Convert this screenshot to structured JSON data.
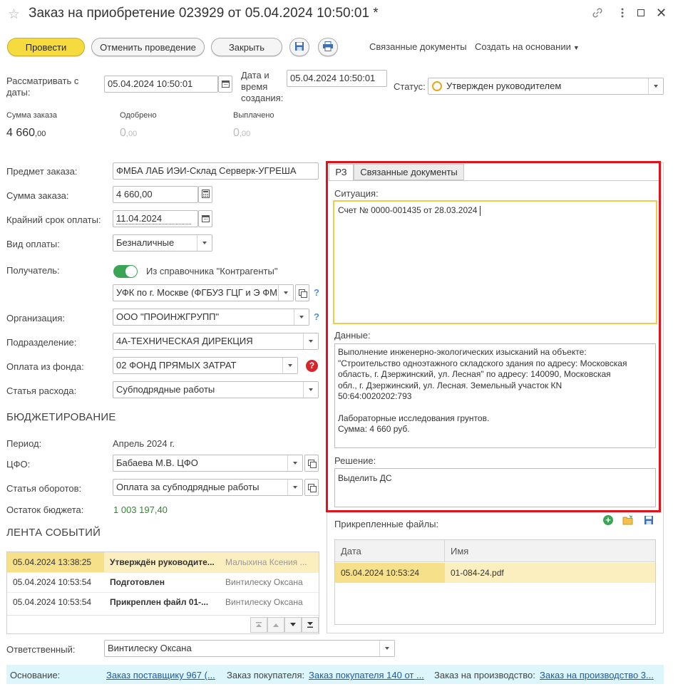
{
  "window": {
    "title": "Заказ на приобретение 023929 от 05.04.2024 10:50:01 *"
  },
  "toolbar": {
    "post_label": "Провести",
    "cancel_post_label": "Отменить проведение",
    "close_label": "Закрыть",
    "related_docs_label": "Связанные документы",
    "create_based_label": "Создать на основании"
  },
  "header": {
    "consider_from_label": "Рассматривать с даты:",
    "consider_from_value": "05.04.2024 10:50:01",
    "created_label": "Дата и время создания:",
    "created_value": "05.04.2024 10:50:01",
    "status_label": "Статус:",
    "status_value": "Утвержден руководителем"
  },
  "totals": {
    "order_sum_label": "Сумма заказа",
    "order_sum_int": "4 660",
    "order_sum_dec": ",00",
    "approved_label": "Одобрено",
    "approved_int": "0",
    "approved_dec": ",00",
    "paid_label": "Выплачено",
    "paid_int": "0",
    "paid_dec": ",00"
  },
  "form": {
    "subject_label": "Предмет заказа:",
    "subject_value": "ФМБА ЛАБ ИЭИ-Склад Серверк-УГРЕША",
    "sum_label": "Сумма заказа:",
    "sum_value": "4 660,00",
    "deadline_label": "Крайний срок оплаты:",
    "deadline_value": "11.04.2024",
    "payment_type_label": "Вид оплаты:",
    "payment_type_value": "Безналичные",
    "recipient_label": "Получатель:",
    "recipient_toggle_label": "Из справочника \"Контрагенты\"",
    "recipient_value": "УФК по г. Москве (ФГБУЗ ГЦГ и Э ФМБА",
    "org_label": "Организация:",
    "org_value": "ООО \"ПРОИНЖГРУПП\"",
    "dept_label": "Подразделение:",
    "dept_value": "4А-ТЕХНИЧЕСКАЯ ДИРЕКЦИЯ",
    "fund_label": "Оплата из фонда:",
    "fund_value": "02 ФОНД ПРЯМЫХ ЗАТРАТ",
    "expense_label": "Статья расхода:",
    "expense_value": "Субподрядные работы"
  },
  "budget": {
    "title": "БЮДЖЕТИРОВАНИЕ",
    "period_label": "Период:",
    "period_value": "Апрель 2024 г.",
    "cfo_label": "ЦФО:",
    "cfo_value": "Бабаева М.В. ЦФО",
    "turnover_label": "Статья оборотов:",
    "turnover_value": "Оплата за субподрядные работы",
    "remainder_label": "Остаток бюджета:",
    "remainder_value": "1 003 197,40"
  },
  "events": {
    "title": "ЛЕНТА СОБЫТИЙ",
    "rows": [
      {
        "date": "05.04.2024 13:38:25",
        "event": "Утверждён руководите...",
        "user": "Малыхина Ксения ..."
      },
      {
        "date": "05.04.2024 10:53:54",
        "event": "Подготовлен",
        "user": "Винтилеску Оксана"
      },
      {
        "date": "05.04.2024 10:53:54",
        "event": "Прикреплен файл 01-...",
        "user": "Винтилеску Оксана"
      }
    ]
  },
  "tabs": {
    "tab1": "РЗ",
    "tab2": "Связанные документы"
  },
  "rz": {
    "situation_label": "Ситуация:",
    "situation_value": "Счет № 0000-001435 от 28.03.2024",
    "data_label": "Данные:",
    "data_line1": "Выполнение инженерно-экологических изысканий на объекте:",
    "data_line2": "\"Строительство одноэтажного складского здания по адресу: Московская",
    "data_line3": "область, г. Дзержинский, ул. Лесная\" по адресу: 140090, Московская",
    "data_line4": "обл., г. Дзержинский, ул. Лесная. Земельный участок КN",
    "data_line5": "50:64:0020202:793",
    "data_line6": "Лабораторные исследования грунтов.",
    "data_line7": "Сумма: 4 660 руб.",
    "decision_label": "Решение:",
    "decision_value": "Выделить ДС"
  },
  "files": {
    "title": "Прикрепленные файлы:",
    "col_date": "Дата",
    "col_name": "Имя",
    "rows": [
      {
        "date": "05.04.2024 10:53:24",
        "name": "01-084-24.pdf"
      }
    ]
  },
  "footer": {
    "responsible_label": "Ответственный:",
    "responsible_value": "Винтилеску Оксана",
    "basis_label": "Основание:",
    "basis_link": "Заказ поставщику 967 (...",
    "customer_order_label": "Заказ покупателя:",
    "customer_order_link": "Заказ покупателя 140 от ...",
    "production_order_label": "Заказ на производство:",
    "production_order_link": "Заказ на производство 3..."
  },
  "colors": {
    "accent_yellow": "#f5db3e",
    "highlight_red": "#e0131c",
    "row_highlight": "#fbefc0",
    "remainder_green": "#2e8b2e",
    "toggle_green": "#3aa655",
    "basis_bg": "#dcf6fb"
  }
}
